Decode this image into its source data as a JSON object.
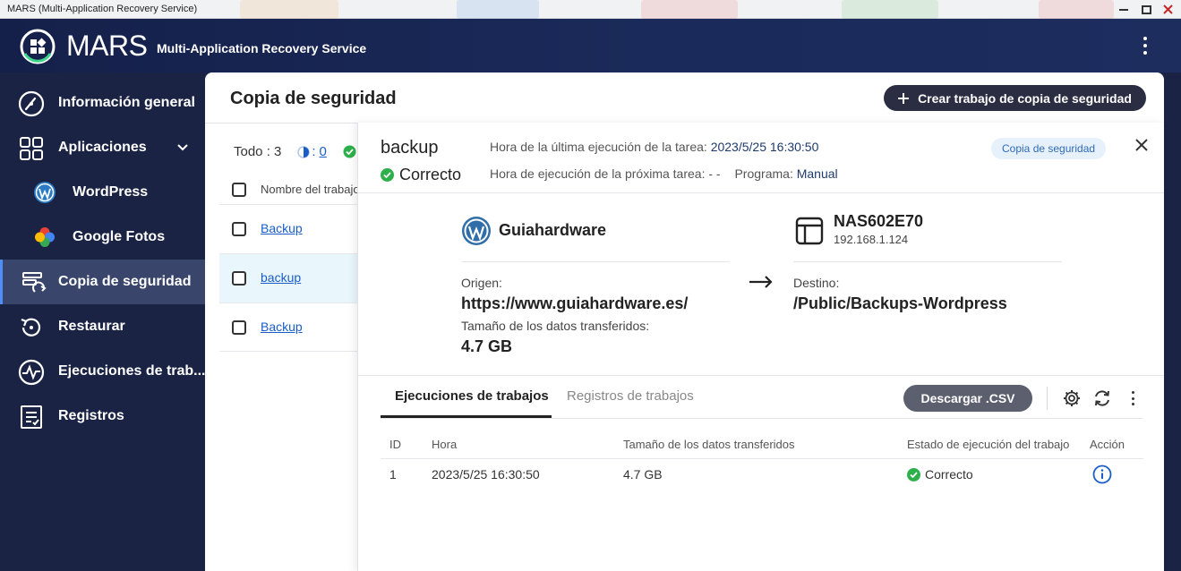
{
  "window": {
    "title": "MARS (Multi-Application Recovery Service)"
  },
  "header": {
    "brand": "MARS",
    "subtitle": "Multi-Application Recovery Service"
  },
  "sidebar": {
    "items": [
      {
        "label": "Información general",
        "icon": "gauge-icon"
      },
      {
        "label": "Aplicaciones",
        "icon": "apps-grid-icon"
      },
      {
        "label": "WordPress",
        "icon": "wordpress-icon"
      },
      {
        "label": "Google Fotos",
        "icon": "google-photos-icon"
      },
      {
        "label": "Copia de seguridad",
        "icon": "backup-icon",
        "active": true
      },
      {
        "label": "Restaurar",
        "icon": "restore-icon"
      },
      {
        "label": "Ejecuciones de trab...",
        "icon": "activity-icon"
      },
      {
        "label": "Registros",
        "icon": "logs-icon"
      }
    ]
  },
  "main": {
    "title": "Copia de seguridad",
    "create_button": "Crear trabajo de copia de seguridad",
    "summary": {
      "total": "Todo : 3",
      "running_sep": ":",
      "running_count": "0"
    },
    "list": {
      "column_name": "Nombre del trabajo",
      "rows": [
        {
          "name": "Backup"
        },
        {
          "name": "backup",
          "selected": true
        },
        {
          "name": "Backup"
        }
      ]
    }
  },
  "detail": {
    "name": "backup",
    "status": "Correcto",
    "last_run_label": "Hora de la última ejecución de la tarea:",
    "last_run_value": "2023/5/25 16:30:50",
    "next_run_label": "Hora de ejecución de la próxima tarea:",
    "next_run_value": "- -",
    "schedule_label": "Programa:",
    "schedule_value": "Manual",
    "badge": "Copia de seguridad",
    "source": {
      "name": "Guiahardware",
      "origin_label": "Origen:",
      "origin_value": "https://www.guiahardware.es/",
      "size_label": "Tamaño de los datos transferidos:",
      "size_value": "4.7 GB"
    },
    "destination": {
      "name": "NAS602E70",
      "ip": "192.168.1.124",
      "dest_label": "Destino:",
      "dest_value": "/Public/Backups-Wordpress"
    },
    "tabs": [
      "Ejecuciones de trabajos",
      "Registros de trabajos"
    ],
    "csv_button": "Descargar .CSV",
    "table": {
      "headers": [
        "ID",
        "Hora",
        "Tamaño de los datos transferidos",
        "Estado de ejecución del trabajo",
        "Acción"
      ],
      "rows": [
        {
          "id": "1",
          "time": "2023/5/25 16:30:50",
          "size": "4.7 GB",
          "state": "Correcto"
        }
      ]
    }
  },
  "colors": {
    "sidebar_bg": "#1a2344",
    "active_bg": "#39456a",
    "link": "#1a5dc9",
    "success": "#2db04b",
    "primary_button": "#2b2d42"
  }
}
